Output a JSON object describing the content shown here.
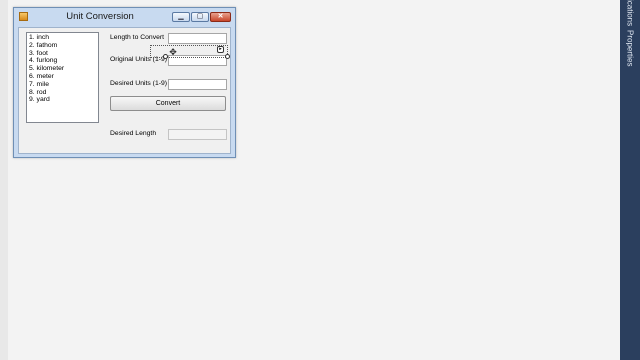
{
  "window": {
    "title": "Unit Conversion",
    "minimize_glyph": "▁",
    "maximize_glyph": "▢",
    "close_glyph": "✕"
  },
  "units_list": [
    "1. inch",
    "2. fathom",
    "3. foot",
    "4. furlong",
    "5. kilometer",
    "6. meter",
    "7. mile",
    "8. rod",
    "9. yard"
  ],
  "form": {
    "length_label": "Length to Convert",
    "length_value": "",
    "original_label": "Original Units (1-9)",
    "original_value": "",
    "desired_units_label": "Desired Units (1-9)",
    "desired_units_value": "",
    "convert_button": "Convert",
    "desired_length_label": "Desired Length",
    "desired_length_value": ""
  },
  "side_panel": {
    "tab_1": "ications",
    "tab_2": "Properties"
  },
  "colors": {
    "window_frame": "#c8daf0",
    "close_button": "#c8462b",
    "side_panel": "#2b3f5e"
  },
  "icons": [
    "app-icon",
    "move-icon",
    "smart-tag-icon"
  ]
}
